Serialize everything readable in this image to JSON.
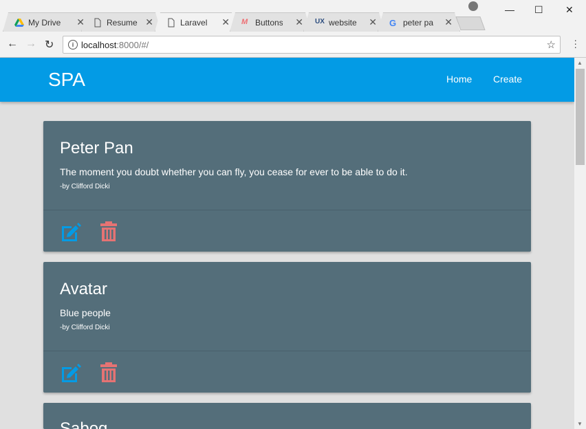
{
  "browser": {
    "tabs": [
      {
        "title": "My Drive",
        "icon": "google-drive-icon"
      },
      {
        "title": "Resume",
        "icon": "document-icon"
      },
      {
        "title": "Laravel",
        "icon": "document-icon",
        "active": true
      },
      {
        "title": "Buttons",
        "icon": "materialize-icon"
      },
      {
        "title": "website",
        "icon": "ux-icon"
      },
      {
        "title": "peter pa",
        "icon": "google-icon"
      }
    ],
    "address": {
      "host": "localhost",
      "rest": ":8000/#/"
    }
  },
  "app": {
    "brand": "SPA",
    "nav": {
      "home": "Home",
      "create": "Create"
    },
    "cards": [
      {
        "title": "Peter Pan",
        "body": "The moment you doubt whether you can fly, you cease for ever to be able to do it.",
        "author": "-by Clifford Dicki"
      },
      {
        "title": "Avatar",
        "body": "Blue people",
        "author": "-by Clifford Dicki"
      },
      {
        "title": "Sabog"
      }
    ]
  },
  "colors": {
    "appbar": "#039be5",
    "card": "#546e7a",
    "edit": "#039be5",
    "delete": "#e57373"
  }
}
